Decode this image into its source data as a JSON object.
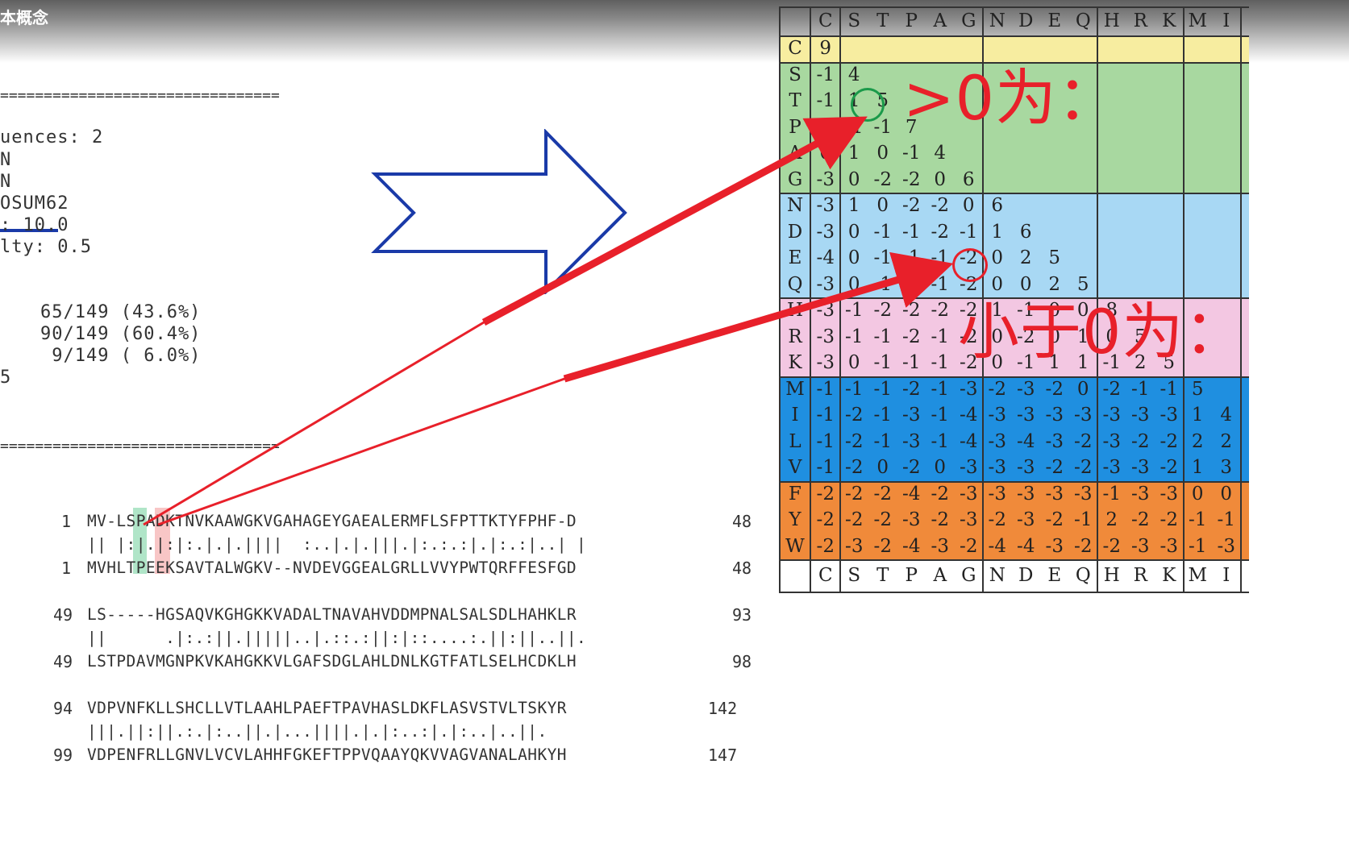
{
  "window": {
    "title": "本概念"
  },
  "params": [
    "uences: 2",
    "N",
    "N",
    "OSUM62",
    ": 10.0",
    "lty: 0.5"
  ],
  "stats": [
    "65/149 (43.6%)",
    "90/149 (60.4%)",
    " 9/149 ( 6.0%)",
    "5"
  ],
  "rule": "================================",
  "alignment": [
    {
      "top_start": "1",
      "top_seq": "MV-LSPADKTNVKAAWGKVGAHAGEYGAEALERMFLSFPTTKTYFPHF-D",
      "top_end": "48",
      "match": "|| |:|.|:|:.|.|.||||  :..|.|.|||.|:.:.:|.|:.:|..| |",
      "bottom_start": "1",
      "bottom_seq": "MVHLTPEEKSAVTALWGKV--NVDEVGGEALGRLLVVYPWTQRFFESFGD",
      "bottom_end": "48"
    },
    {
      "top_start": "49",
      "top_seq": "LS-----HGSAQVKGHGKKVADALTNAVAHVDDMPNALSALSDLHAHKLR",
      "top_end": "93",
      "match": "||      .|:.:||.|||||..|.::.:||:|::....:.||:||..||.",
      "bottom_start": "49",
      "bottom_seq": "LSTPDAVMGNPKVKAHGKKVLGAFSDGLAHLDNLKGTFATLSELHCDKLH",
      "bottom_end": "98"
    },
    {
      "top_start": "94",
      "top_seq": "VDPVNFKLLSHCLLVTLAAHLPAEFTPAVHASLDKFLASVSTVLTSKYR",
      "top_end": "142",
      "match": "|||.||:||.:.|:..||.|...||||.|.|:..:|.|:..|..||.",
      "bottom_start": "99",
      "bottom_seq": "VDPENFRLLGNVLVCVLAHHFGKEFTPPVQAAYQKVVAGVANALAHKYH",
      "bottom_end": "147"
    }
  ],
  "matrix": {
    "columns": [
      "C",
      "S",
      "T",
      "P",
      "A",
      "G",
      "N",
      "D",
      "E",
      "Q",
      "H",
      "R",
      "K",
      "M",
      "I"
    ],
    "rows": [
      {
        "label": "C",
        "values": [
          "9"
        ]
      },
      {
        "label": "S",
        "values": [
          "-1",
          "4"
        ]
      },
      {
        "label": "T",
        "values": [
          "-1",
          "1",
          "5"
        ]
      },
      {
        "label": "P",
        "values": [
          "-3",
          "-1",
          "-1",
          "7"
        ]
      },
      {
        "label": "A",
        "values": [
          "0",
          "1",
          "0",
          "-1",
          "4"
        ]
      },
      {
        "label": "G",
        "values": [
          "-3",
          "0",
          "-2",
          "-2",
          "0",
          "6"
        ]
      },
      {
        "label": "N",
        "values": [
          "-3",
          "1",
          "0",
          "-2",
          "-2",
          "0",
          "6"
        ]
      },
      {
        "label": "D",
        "values": [
          "-3",
          "0",
          "-1",
          "-1",
          "-2",
          "-1",
          "1",
          "6"
        ]
      },
      {
        "label": "E",
        "values": [
          "-4",
          "0",
          "-1",
          "-1",
          "-1",
          "-2",
          "0",
          "2",
          "5"
        ]
      },
      {
        "label": "Q",
        "values": [
          "-3",
          "0",
          "-1",
          "-1",
          "-1",
          "-2",
          "0",
          "0",
          "2",
          "5"
        ]
      },
      {
        "label": "H",
        "values": [
          "-3",
          "-1",
          "-2",
          "-2",
          "-2",
          "-2",
          "1",
          "-1",
          "0",
          "0",
          "8"
        ]
      },
      {
        "label": "R",
        "values": [
          "-3",
          "-1",
          "-1",
          "-2",
          "-1",
          "-2",
          "0",
          "-2",
          "0",
          "1",
          "0",
          "5"
        ]
      },
      {
        "label": "K",
        "values": [
          "-3",
          "0",
          "-1",
          "-1",
          "-1",
          "-2",
          "0",
          "-1",
          "1",
          "1",
          "-1",
          "2",
          "5"
        ]
      },
      {
        "label": "M",
        "values": [
          "-1",
          "-1",
          "-1",
          "-2",
          "-1",
          "-3",
          "-2",
          "-3",
          "-2",
          "0",
          "-2",
          "-1",
          "-1",
          "5"
        ]
      },
      {
        "label": "I",
        "values": [
          "-1",
          "-2",
          "-1",
          "-3",
          "-1",
          "-4",
          "-3",
          "-3",
          "-3",
          "-3",
          "-3",
          "-3",
          "-3",
          "1",
          "4"
        ]
      },
      {
        "label": "L",
        "values": [
          "-1",
          "-2",
          "-1",
          "-3",
          "-1",
          "-4",
          "-3",
          "-4",
          "-3",
          "-2",
          "-3",
          "-2",
          "-2",
          "2",
          "2"
        ]
      },
      {
        "label": "V",
        "values": [
          "-1",
          "-2",
          "0",
          "-2",
          "0",
          "-3",
          "-3",
          "-3",
          "-2",
          "-2",
          "-3",
          "-3",
          "-2",
          "1",
          "3"
        ]
      },
      {
        "label": "F",
        "values": [
          "-2",
          "-2",
          "-2",
          "-4",
          "-2",
          "-3",
          "-3",
          "-3",
          "-3",
          "-3",
          "-1",
          "-3",
          "-3",
          "0",
          "0"
        ]
      },
      {
        "label": "Y",
        "values": [
          "-2",
          "-2",
          "-2",
          "-3",
          "-2",
          "-3",
          "-2",
          "-3",
          "-2",
          "-1",
          "2",
          "-2",
          "-2",
          "-1",
          "-1"
        ]
      },
      {
        "label": "W",
        "values": [
          "-2",
          "-3",
          "-2",
          "-4",
          "-3",
          "-2",
          "-4",
          "-4",
          "-3",
          "-2",
          "-2",
          "-3",
          "-3",
          "-1",
          "-3"
        ]
      }
    ],
    "group_colors": {
      "C": "#f7eda0",
      "STPAG": "#a8d8a0",
      "NDEQ": "#a8d8f4",
      "HRK": "#f3c7e2",
      "MILV": "#1f8fe0",
      "FYW": "#f08a3a"
    }
  },
  "annotations": {
    "positive": ">0为：",
    "negative": "小于0为："
  },
  "colors": {
    "arrow_red": "#e8202a",
    "outline_blue": "#1a3aa8",
    "circle_green": "#1b9a4a",
    "highlight_green": "#6fcf9a",
    "highlight_red": "#f4a0a0"
  }
}
